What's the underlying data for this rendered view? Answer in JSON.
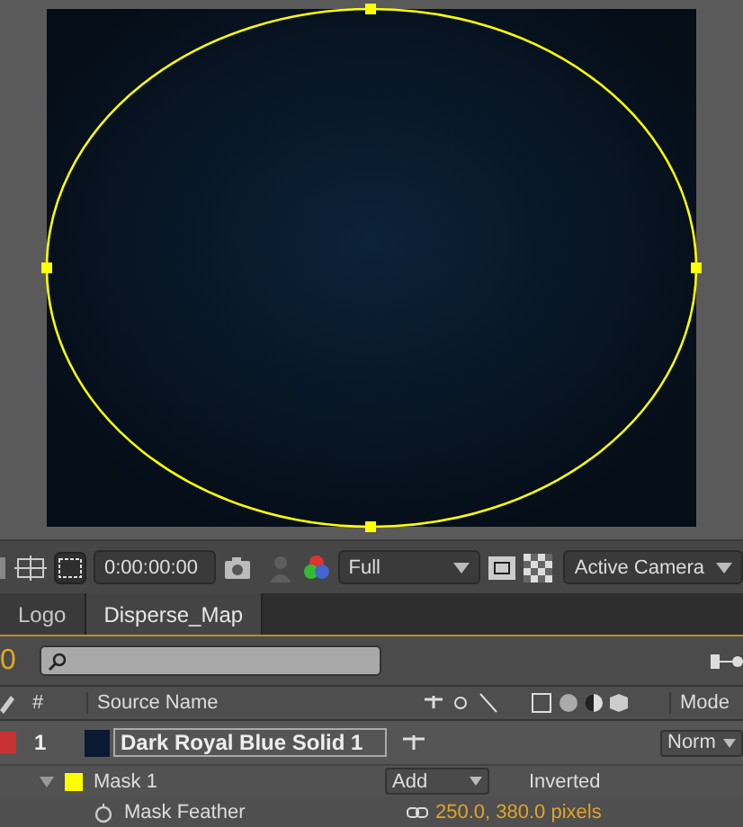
{
  "toolbar": {
    "timecode": "0:00:00:00",
    "resolution": "Full",
    "view": "Active Camera"
  },
  "tabs": [
    {
      "label": "Logo",
      "selected": false
    },
    {
      "label": "Disperse_Map",
      "selected": true
    }
  ],
  "timeline": {
    "current_time": "0",
    "columns": [
      "#",
      "Source Name",
      "Mode"
    ],
    "layers": [
      {
        "number": "1",
        "name": "Dark Royal Blue Solid 1",
        "color": "#c83232",
        "swatch": {
          "color": "#0a1a33"
        },
        "mode": "Norm",
        "masks": [
          {
            "name": "Mask 1",
            "color": "#ffff00",
            "expanded": true,
            "mode": "Add",
            "inverted_label": "Inverted",
            "properties": [
              {
                "name": "Mask Feather",
                "value": "250.0, 380.0 pixels"
              }
            ]
          }
        ]
      }
    ]
  }
}
